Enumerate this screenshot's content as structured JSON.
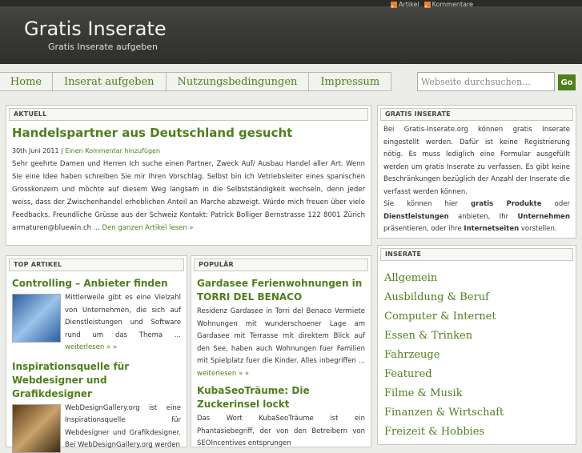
{
  "header": {
    "title": "Gratis Inserate",
    "subtitle": "Gratis Inserate aufgeben",
    "feeds": [
      {
        "label": "Artikel",
        "icon": "rss-icon"
      },
      {
        "label": "Kommentare",
        "icon": "rss-icon"
      }
    ]
  },
  "nav": {
    "items": [
      "Home",
      "Inserat aufgeben",
      "Nutzungsbedingungen",
      "Impressum"
    ],
    "search_placeholder": "Webseite durchsuchen...",
    "go_label": "Go"
  },
  "aktuell": {
    "heading": "AKTUELL",
    "title": "Handelspartner aus Deutschland gesucht",
    "date": "30th Juni 2011",
    "separator": " | ",
    "comment_link": "Einen Kommentar hinzufügen",
    "body": "Sehr geehrte Damen und Herren Ich suche einen Partner, Zweck Auf/ Ausbau Handel aller Art. Wenn Sie eine Idee haben schreiben Sie mir Ihren Vorschlag. Selbst bin ich Vetriebsleiter eines spanischen Grosskonzern und möchte auf diesem Weg langsam in die Selbstständigkeit wechseln, denn jeder weiss, dass der Zwischenhandel erheblichen Anteil an Marche abzweigt. Würde mich freuen über viele Feedbacks. Freundliche Grüsse aus der Schweiz    Kontakt: Patrick Bolliger Bernstrasse 122 8001 Zürich armaturen@bluewin.ch ...",
    "more_link": "Den ganzen Artikel lesen »"
  },
  "top_artikel": {
    "heading": "TOP ARTIKEL",
    "items": [
      {
        "title": "Controlling – Anbieter finden",
        "body": "Mittlerweile gibt es eine Vielzahl von Unternehmen, die sich auf Dienstleistungen und Software rund um das Thema ...",
        "more": "weiterlesen » »"
      },
      {
        "title": "Inspirationsquelle für Webdesigner und Grafikdesigner",
        "body": "WebDesignGallery.org ist eine Inspirationsquelle für Webdesigner und Grafikdesigner. Bei WebDesignGallery.org werden",
        "more": ""
      }
    ]
  },
  "populaer": {
    "heading": "POPULÄR",
    "items": [
      {
        "title": "Gardasee Ferienwohnungen in TORRI DEL BENACO",
        "body": "Residenz Gardasee in Torri del Benaco Vermiete Wohnungen mit wunderschoener Lage am Gardasee mit Terrasse mit direktem Blick auf den See, haben auch Wohnungen fuer Familien mit Spielplatz fuer die Kinder. Alles inbegriffen ...",
        "more": "weiterlesen » »"
      },
      {
        "title": "KubaSeoTräume: Die Zuckerinsel lockt",
        "body": "Das Wort KubaSeoTräume ist ein Phantasiebegriff, der von den Betreibern von SEOIncentives entsprungen",
        "more": ""
      }
    ]
  },
  "gratis": {
    "heading": "GRATIS INSERATE",
    "p1": "Bei Gratis-Inserate.org können gratis Inserate eingestellt werden. Dafür ist keine Registrierung nötig. Es muss lediglich eine Formular ausgefüllt werden um gratis Inserate zu verfassen. Es gibt keine Beschränkungen bezüglich der Anzahl der Inserate die verfasst werden können.",
    "p2_a": "Sie können hier ",
    "p2_b": "gratis Produkte",
    "p2_c": " oder ",
    "p2_d": "Dienstleistungen",
    "p2_e": " anbieten, Ihr ",
    "p2_f": "Unternehmen",
    "p2_g": " präsentieren, oder ihre ",
    "p2_h": "Internetseiten",
    "p2_i": " vorstellen."
  },
  "inserate": {
    "heading": "INSERATE",
    "categories": [
      "Allgemein",
      "Ausbildung & Beruf",
      "Computer & Internet",
      "Essen & Trinken",
      "Fahrzeuge",
      "Featured",
      "Filme & Musik",
      "Finanzen & Wirtschaft",
      "Freizeit & Hobbies"
    ]
  },
  "colors": {
    "accent": "#4e7f1a",
    "header": "#3b3c39",
    "background": "#ecece9"
  }
}
